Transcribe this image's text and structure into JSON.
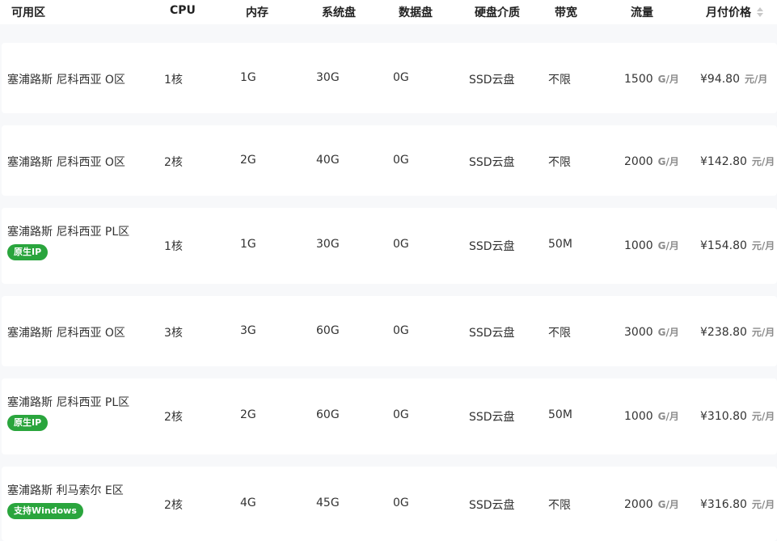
{
  "table": {
    "headers": {
      "region": "可用区",
      "cpu": "CPU",
      "memory": "内存",
      "system_disk": "系统盘",
      "data_disk": "数据盘",
      "disk_media": "硬盘介质",
      "bandwidth": "带宽",
      "traffic": "流量",
      "monthly_price": "月付价格"
    },
    "sort_icon": "sort-updown-icon",
    "traffic_unit": "G/月",
    "price_unit": "元/月",
    "badge_color": "#2aa53d",
    "rows": [
      {
        "region": "塞浦路斯 尼科西亚 O区",
        "badge": "",
        "cpu": "1核",
        "memory": "1G",
        "system_disk": "30G",
        "data_disk": "0G",
        "disk_media": "SSD云盘",
        "bandwidth": "不限",
        "traffic": "1500",
        "price": "¥94.80"
      },
      {
        "region": "塞浦路斯 尼科西亚 O区",
        "badge": "",
        "cpu": "2核",
        "memory": "2G",
        "system_disk": "40G",
        "data_disk": "0G",
        "disk_media": "SSD云盘",
        "bandwidth": "不限",
        "traffic": "2000",
        "price": "¥142.80"
      },
      {
        "region": "塞浦路斯 尼科西亚 PL区",
        "badge": "原生IP",
        "cpu": "1核",
        "memory": "1G",
        "system_disk": "30G",
        "data_disk": "0G",
        "disk_media": "SSD云盘",
        "bandwidth": "50M",
        "traffic": "1000",
        "price": "¥154.80"
      },
      {
        "region": "塞浦路斯 尼科西亚 O区",
        "badge": "",
        "cpu": "3核",
        "memory": "3G",
        "system_disk": "60G",
        "data_disk": "0G",
        "disk_media": "SSD云盘",
        "bandwidth": "不限",
        "traffic": "3000",
        "price": "¥238.80"
      },
      {
        "region": "塞浦路斯 尼科西亚 PL区",
        "badge": "原生IP",
        "cpu": "2核",
        "memory": "2G",
        "system_disk": "60G",
        "data_disk": "0G",
        "disk_media": "SSD云盘",
        "bandwidth": "50M",
        "traffic": "1000",
        "price": "¥310.80"
      },
      {
        "region": "塞浦路斯 利马索尔 E区",
        "badge": "支持Windows",
        "cpu": "2核",
        "memory": "4G",
        "system_disk": "45G",
        "data_disk": "0G",
        "disk_media": "SSD云盘",
        "bandwidth": "不限",
        "traffic": "2000",
        "price": "¥316.80"
      }
    ]
  }
}
